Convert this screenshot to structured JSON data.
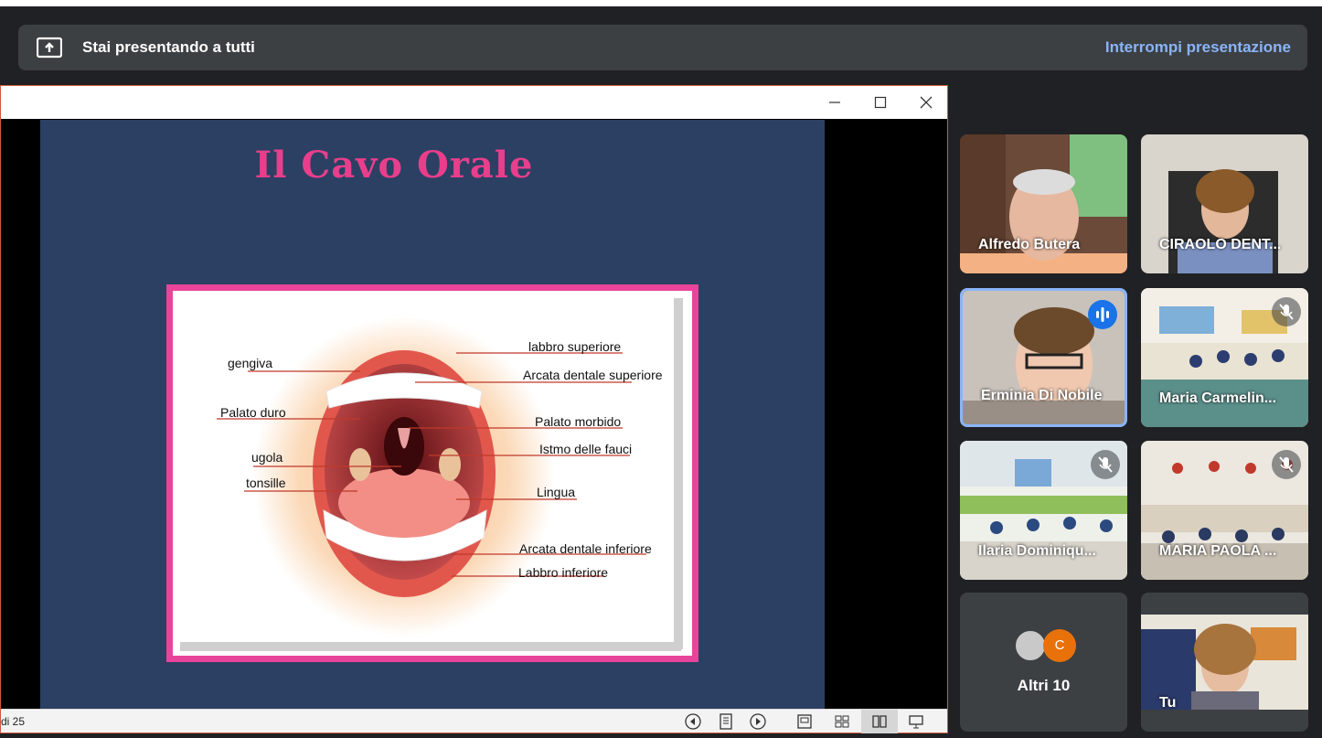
{
  "banner": {
    "label": "Stai presentando a tutti",
    "stop_label": "Interrompi presentazione"
  },
  "presentation": {
    "slide_title": "Il Cavo Orale",
    "status_text": "di 25",
    "diagram_labels": {
      "gengiva": "gengiva",
      "palato_duro": "Palato duro",
      "ugola": "ugola",
      "tonsille": "tonsille",
      "labbro_superiore": "labbro superiore",
      "arcata_superiore": "Arcata dentale superiore",
      "palato_morbido": "Palato morbido",
      "istmo": "Istmo delle fauci",
      "lingua": "Lingua",
      "arcata_inferiore": "Arcata dentale inferiore",
      "labbro_inferiore": "Labbro inferiore"
    }
  },
  "participants": [
    {
      "name": "Alfredo Butera"
    },
    {
      "name": "CIRAOLO DENT..."
    },
    {
      "name": "Erminia Di Nobile"
    },
    {
      "name": "Maria Carmelin..."
    },
    {
      "name": "Ilaria Dominiqu..."
    },
    {
      "name": "MARIA PAOLA ..."
    },
    {
      "name": "Tu"
    }
  ],
  "others": {
    "avatar_letter": "C",
    "label": "Altri 10"
  },
  "colors": {
    "accent": "#8ab4f8",
    "slide_bg": "#2b4063",
    "title_pink": "#e83e8c"
  }
}
